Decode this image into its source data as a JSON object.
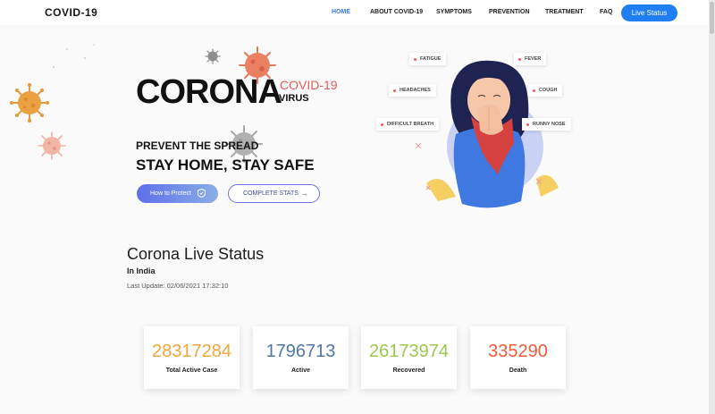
{
  "header": {
    "logo": "COVID-19",
    "nav": [
      {
        "label": "HOME"
      },
      {
        "label": "ABOUT COVID-19"
      },
      {
        "label": "SYMPTOMS"
      },
      {
        "label": "PREVENTION"
      },
      {
        "label": "TREATMENT"
      },
      {
        "label": "FAQ"
      }
    ],
    "live_status_label": "Live Status"
  },
  "hero": {
    "corona": "CORONA",
    "covid": "COVID-19",
    "virus": "VIRUS",
    "tagline": "PREVENT THE SPREAD",
    "headline": "STAY HOME, STAY SAFE",
    "protect_label": "How to Protect",
    "stats_label": "COMPLETE STATS",
    "symptoms": [
      "FATIGUE",
      "FEVER",
      "HEADACHES",
      "COUGH",
      "DIFFICULT BREATH",
      "RUNNY NOSE"
    ]
  },
  "status": {
    "title": "Corona Live Status",
    "region": "In India",
    "last_update": "Last Update: 02/06/2021 17:32:10",
    "cards": [
      {
        "value": "28317284",
        "label": "Total Active Case",
        "color": "#f0a63c"
      },
      {
        "value": "1796713",
        "label": "Active",
        "color": "#4f78a8"
      },
      {
        "value": "26173974",
        "label": "Recovered",
        "color": "#9bc94f"
      },
      {
        "value": "335290",
        "label": "Death",
        "color": "#ef5c3b"
      }
    ]
  },
  "colors": {
    "accent": "#1f7ef2",
    "nav_active": "#3c7be0",
    "covid_red": "#ea5a5a"
  }
}
